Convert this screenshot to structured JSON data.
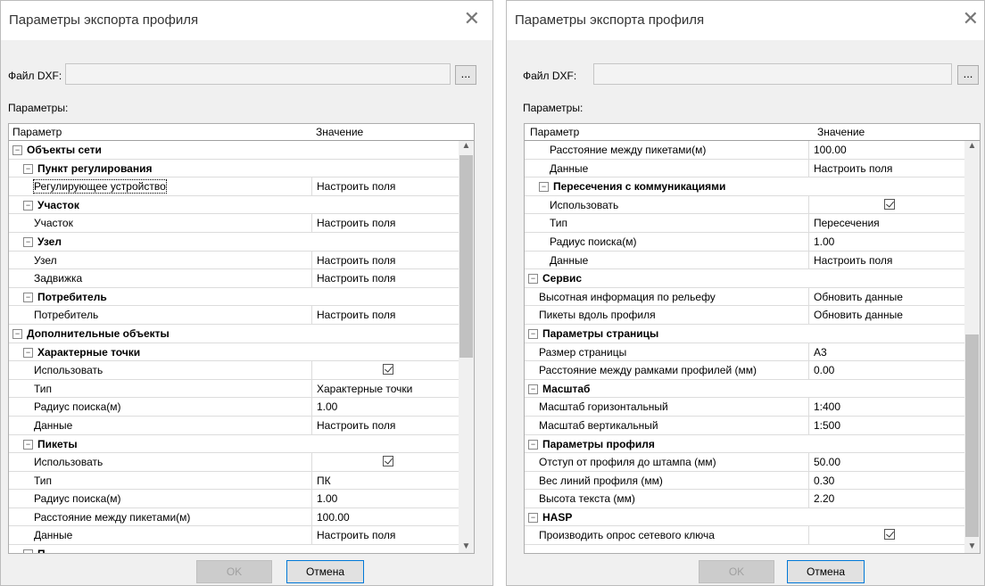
{
  "dialog_left": {
    "title": "Параметры экспорта профиля",
    "file_label": "Файл DXF:",
    "file_value": "",
    "browse_label": "...",
    "params_label": "Параметры:",
    "col_param": "Параметр",
    "col_value": "Значение",
    "ok_label": "OK",
    "cancel_label": "Отмена",
    "rows": [
      {
        "kind": "cat",
        "level": 0,
        "text": "Объекты сети",
        "toggle": "⊟"
      },
      {
        "kind": "cat",
        "level": 1,
        "text": "Пункт регулирования",
        "toggle": "⊟"
      },
      {
        "kind": "prop",
        "level": 2,
        "text": "Регулирующее устройство",
        "value": "Настроить поля",
        "selected": true
      },
      {
        "kind": "cat",
        "level": 1,
        "text": "Участок",
        "toggle": "⊟"
      },
      {
        "kind": "prop",
        "level": 2,
        "text": "Участок",
        "value": "Настроить поля"
      },
      {
        "kind": "cat",
        "level": 1,
        "text": "Узел",
        "toggle": "⊟"
      },
      {
        "kind": "prop",
        "level": 2,
        "text": "Узел",
        "value": "Настроить поля"
      },
      {
        "kind": "prop",
        "level": 2,
        "text": "Задвижка",
        "value": "Настроить поля"
      },
      {
        "kind": "cat",
        "level": 1,
        "text": "Потребитель",
        "toggle": "⊟"
      },
      {
        "kind": "prop",
        "level": 2,
        "text": "Потребитель",
        "value": "Настроить поля"
      },
      {
        "kind": "cat",
        "level": 0,
        "text": "Дополнительные объекты",
        "toggle": "⊟"
      },
      {
        "kind": "cat",
        "level": 1,
        "text": "Характерные точки",
        "toggle": "⊟"
      },
      {
        "kind": "prop",
        "level": 2,
        "text": "Использовать",
        "value": "",
        "checkbox": true
      },
      {
        "kind": "prop",
        "level": 2,
        "text": "Тип",
        "value": "Характерные точки"
      },
      {
        "kind": "prop",
        "level": 2,
        "text": "Радиус поиска(м)",
        "value": "1.00"
      },
      {
        "kind": "prop",
        "level": 2,
        "text": "Данные",
        "value": "Настроить поля"
      },
      {
        "kind": "cat",
        "level": 1,
        "text": "Пикеты",
        "toggle": "⊟"
      },
      {
        "kind": "prop",
        "level": 2,
        "text": "Использовать",
        "value": "",
        "checkbox": true
      },
      {
        "kind": "prop",
        "level": 2,
        "text": "Тип",
        "value": "ПК"
      },
      {
        "kind": "prop",
        "level": 2,
        "text": "Радиус поиска(м)",
        "value": "1.00"
      },
      {
        "kind": "prop",
        "level": 2,
        "text": "Расстояние между пикетами(м)",
        "value": "100.00"
      },
      {
        "kind": "prop",
        "level": 2,
        "text": "Данные",
        "value": "Настроить поля"
      },
      {
        "kind": "cat",
        "level": 1,
        "text": "П",
        "toggle": "⊟"
      }
    ],
    "scroll_fraction": 0.0,
    "scroll_visible": 0.53
  },
  "dialog_right": {
    "title": "Параметры экспорта профиля",
    "file_label": "Файл DXF:",
    "file_value": "",
    "browse_label": "...",
    "params_label": "Параметры:",
    "col_param": "Параметр",
    "col_value": "Значение",
    "ok_label": "OK",
    "cancel_label": "Отмена",
    "rows": [
      {
        "kind": "prop",
        "level": 2,
        "text": "Расстояние между пикетами(м)",
        "value": "100.00"
      },
      {
        "kind": "prop",
        "level": 2,
        "text": "Данные",
        "value": "Настроить поля"
      },
      {
        "kind": "cat",
        "level": 1,
        "text": "Пересечения с коммуникациями",
        "toggle": "⊟"
      },
      {
        "kind": "prop",
        "level": 2,
        "text": "Использовать",
        "value": "",
        "checkbox": true
      },
      {
        "kind": "prop",
        "level": 2,
        "text": "Тип",
        "value": "Пересечения"
      },
      {
        "kind": "prop",
        "level": 2,
        "text": "Радиус поиска(м)",
        "value": "1.00"
      },
      {
        "kind": "prop",
        "level": 2,
        "text": "Данные",
        "value": "Настроить поля"
      },
      {
        "kind": "cat",
        "level": 0,
        "text": "Сервис",
        "toggle": "⊟"
      },
      {
        "kind": "prop",
        "level": 1,
        "text": "Высотная информация по рельефу",
        "value": "Обновить данные"
      },
      {
        "kind": "prop",
        "level": 1,
        "text": "Пикеты вдоль профиля",
        "value": "Обновить данные"
      },
      {
        "kind": "cat",
        "level": 0,
        "text": "Параметры страницы",
        "toggle": "⊟"
      },
      {
        "kind": "prop",
        "level": 1,
        "text": "Размер страницы",
        "value": "A3"
      },
      {
        "kind": "prop",
        "level": 1,
        "text": "Расстояние между рамками профилей (мм)",
        "value": "0.00"
      },
      {
        "kind": "cat",
        "level": 0,
        "text": "Масштаб",
        "toggle": "⊟"
      },
      {
        "kind": "prop",
        "level": 1,
        "text": "Масштаб горизонтальный",
        "value": "1:400"
      },
      {
        "kind": "prop",
        "level": 1,
        "text": "Масштаб вертикальный",
        "value": "1:500"
      },
      {
        "kind": "cat",
        "level": 0,
        "text": "Параметры профиля",
        "toggle": "⊟"
      },
      {
        "kind": "prop",
        "level": 1,
        "text": "Отступ от профиля до штампа (мм)",
        "value": "50.00"
      },
      {
        "kind": "prop",
        "level": 1,
        "text": "Вес линий профиля (мм)",
        "value": "0.30"
      },
      {
        "kind": "prop",
        "level": 1,
        "text": "Высота текста (мм)",
        "value": "2.20"
      },
      {
        "kind": "cat",
        "level": 0,
        "text": "HASP",
        "toggle": "⊟"
      },
      {
        "kind": "prop",
        "level": 1,
        "text": "Производить опрос сетевого ключа",
        "value": "",
        "checkbox": true
      }
    ],
    "scroll_fraction": 1.0,
    "scroll_visible": 0.53
  }
}
